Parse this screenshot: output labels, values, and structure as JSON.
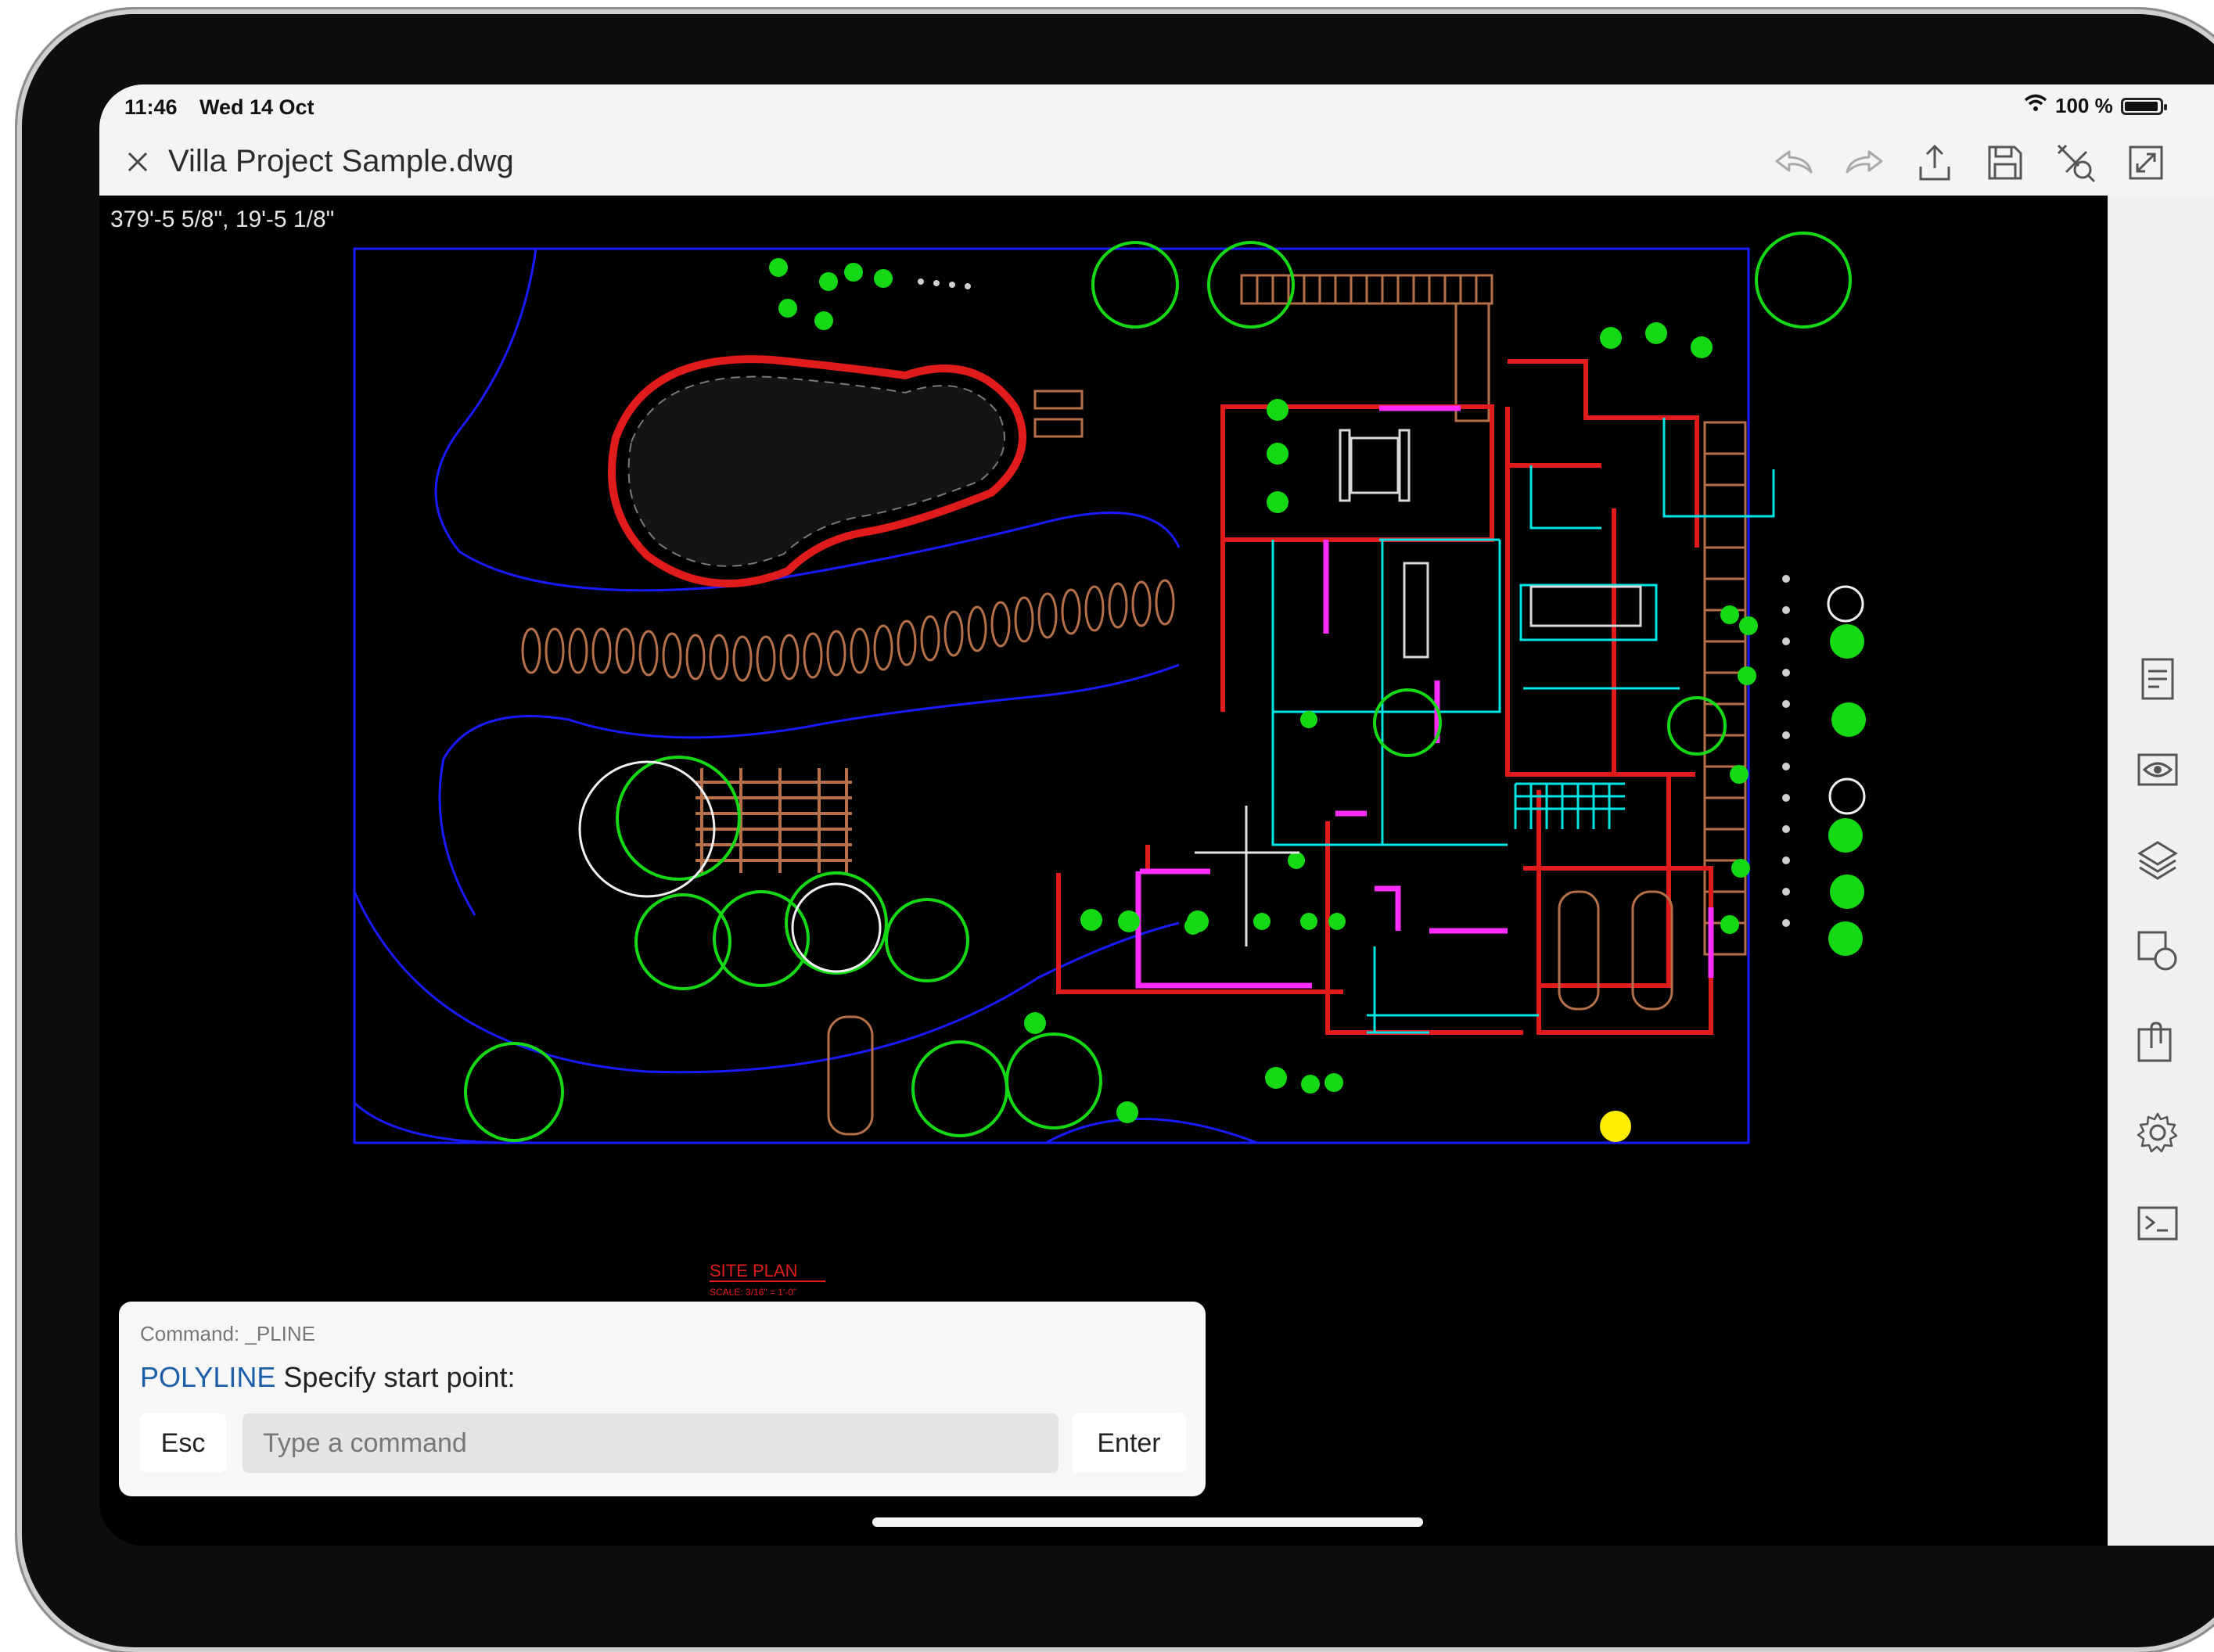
{
  "status_bar": {
    "time": "11:46",
    "date": "Wed 14 Oct",
    "battery": "100 %",
    "battery_level": 0.95,
    "wifi_icon": "wifi-icon"
  },
  "title_bar": {
    "document_title": "Villa Project Sample.dwg",
    "close_icon": "close-icon",
    "actions": [
      "undo-icon",
      "redo-icon",
      "share-icon",
      "save-icon",
      "measure-icon",
      "fullscreen-icon"
    ]
  },
  "canvas": {
    "coordinates": "379'-5 5/8\",  19'-5 1/8\"",
    "plan_title": "SITE PLAN",
    "plan_scale": "SCALE: 3/16\" = 1'-0\"",
    "colors": {
      "background": "#000000",
      "boundary": "#1a1aff",
      "walls": "#e01b1b",
      "interior": "#00e5e5",
      "furniture": "#ff2bff",
      "landscape": "#15d915",
      "paving": "#b5704a",
      "marker": "#ffee00"
    }
  },
  "right_toolbar": {
    "tools": [
      "properties-icon",
      "view-icon",
      "layers-icon",
      "draw-icon",
      "annotate-icon",
      "settings-icon",
      "command-line-icon"
    ]
  },
  "command_panel": {
    "history": "Command: _PLINE",
    "prompt_keyword": "POLYLINE",
    "prompt_text": " Specify start point:",
    "esc_label": "Esc",
    "input_placeholder": "Type a command",
    "enter_label": "Enter"
  }
}
